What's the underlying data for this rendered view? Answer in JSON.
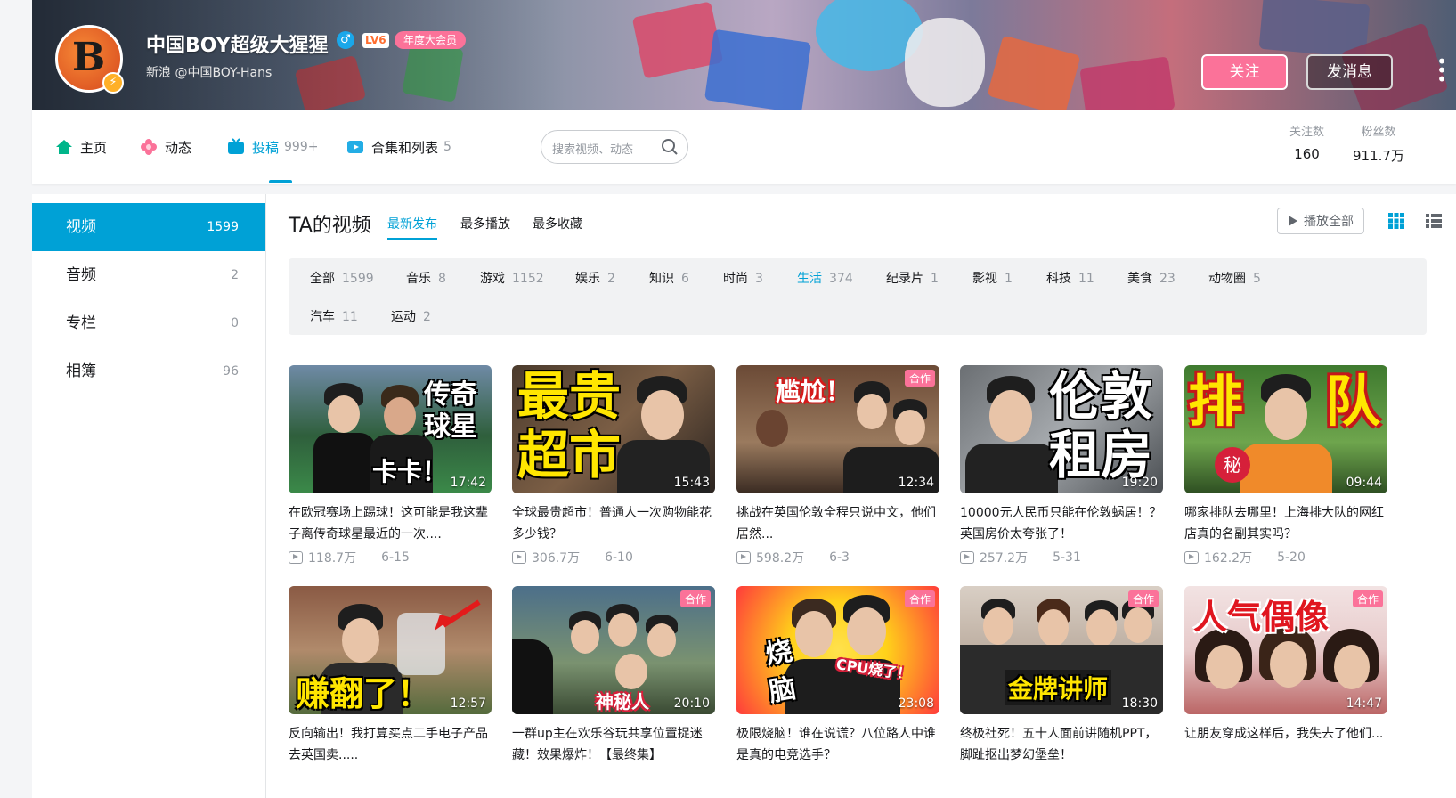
{
  "header": {
    "username": "中国BOY超级大猩猩",
    "level": "LV6",
    "vip_badge": "年度大会员",
    "sign": "新浪 @中国BOY-Hans",
    "follow_label": "关注",
    "message_label": "发消息",
    "more_label": "⋮"
  },
  "nav": {
    "home": "主页",
    "dynamic": "动态",
    "submissions": "投稿",
    "submissions_count": "999+",
    "collections": "合集和列表",
    "collections_count": "5",
    "search_placeholder": "搜索视频、动态",
    "following_label": "关注数",
    "following_value": "160",
    "fans_label": "粉丝数",
    "fans_value": "911.7万"
  },
  "sidebar": [
    {
      "label": "视频",
      "count": "1599"
    },
    {
      "label": "音频",
      "count": "2"
    },
    {
      "label": "专栏",
      "count": "0"
    },
    {
      "label": "相簿",
      "count": "96"
    }
  ],
  "main": {
    "title": "TA的视频",
    "sorts": [
      "最新发布",
      "最多播放",
      "最多收藏"
    ],
    "play_all": "播放全部"
  },
  "categories": [
    {
      "label": "全部",
      "count": "1599"
    },
    {
      "label": "音乐",
      "count": "8"
    },
    {
      "label": "游戏",
      "count": "1152"
    },
    {
      "label": "娱乐",
      "count": "2"
    },
    {
      "label": "知识",
      "count": "6"
    },
    {
      "label": "时尚",
      "count": "3"
    },
    {
      "label": "生活",
      "count": "374"
    },
    {
      "label": "纪录片",
      "count": "1"
    },
    {
      "label": "影视",
      "count": "1"
    },
    {
      "label": "科技",
      "count": "11"
    },
    {
      "label": "美食",
      "count": "23"
    },
    {
      "label": "动物圈",
      "count": "5"
    },
    {
      "label": "汽车",
      "count": "11"
    },
    {
      "label": "运动",
      "count": "2"
    }
  ],
  "videos": [
    {
      "title": "在欧冠赛场上踢球！这可能是我这辈子离传奇球星最近的一次....",
      "views": "118.7万",
      "date": "6-15",
      "duration": "17:42",
      "overlay": [
        "传奇",
        "球星",
        "卡卡！"
      ],
      "coop": ""
    },
    {
      "title": "全球最贵超市！普通人一次购物能花多少钱？",
      "views": "306.7万",
      "date": "6-10",
      "duration": "15:43",
      "overlay": [
        "最贵",
        "超市"
      ],
      "coop": ""
    },
    {
      "title": "挑战在英国伦敦全程只说中文，他们居然...",
      "views": "598.2万",
      "date": "6-3",
      "duration": "12:34",
      "overlay": [
        "尴尬！"
      ],
      "coop": "合作"
    },
    {
      "title": "10000元人民币只能在伦敦蜗居！？英国房价太夸张了！",
      "views": "257.2万",
      "date": "5-31",
      "duration": "19:20",
      "overlay": [
        "伦敦",
        "租房"
      ],
      "coop": ""
    },
    {
      "title": "哪家排队去哪里！上海排大队的网红店真的名副其实吗？",
      "views": "162.2万",
      "date": "5-20",
      "duration": "09:44",
      "overlay": [
        "排",
        "队",
        "秘"
      ],
      "coop": ""
    },
    {
      "title": "反向输出！我打算买点二手电子产品去英国卖.....",
      "views": "",
      "date": "",
      "duration": "12:57",
      "overlay": [
        "赚翻了！"
      ],
      "coop": ""
    },
    {
      "title": "一群up主在欢乐谷玩共享位置捉迷藏！效果爆炸！【最终集】",
      "views": "",
      "date": "",
      "duration": "20:10",
      "overlay": [
        "神秘人"
      ],
      "coop": "合作"
    },
    {
      "title": "极限烧脑！谁在说谎？八位路人中谁是真的电竞选手？",
      "views": "",
      "date": "",
      "duration": "23:08",
      "overlay": [
        "烧",
        "脑",
        "CPU烧了！"
      ],
      "coop": "合作"
    },
    {
      "title": "终极社死！五十人面前讲随机PPT，脚趾抠出梦幻堡垒！",
      "views": "",
      "date": "",
      "duration": "18:30",
      "overlay": [
        "金牌讲师"
      ],
      "coop": "合作"
    },
    {
      "title": "让朋友穿成这样后，我失去了他们...",
      "views": "",
      "date": "",
      "duration": "14:47",
      "overlay": [
        "人气偶像"
      ],
      "coop": "合作"
    }
  ]
}
